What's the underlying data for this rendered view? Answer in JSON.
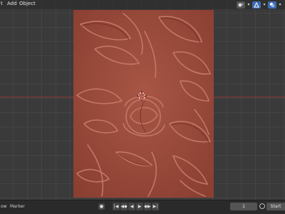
{
  "header": {
    "menus": [
      "t",
      "Add",
      "Object"
    ]
  },
  "viewport": {
    "relief_color": "#9a4a3a",
    "x_axis_color": "#8a3b3b"
  },
  "timeline": {
    "view_label": "ow",
    "marker_label": "Marker",
    "keyframe_icon": "keyframe-dot-icon",
    "controls": [
      "|◀",
      "◀◆",
      "◀",
      "▶",
      "◆▶",
      "▶|"
    ],
    "current_frame": "1",
    "start_label": "Start"
  },
  "header_icons": [
    "shading-object-icon",
    "gizmo-icon",
    "overlay-icon"
  ]
}
